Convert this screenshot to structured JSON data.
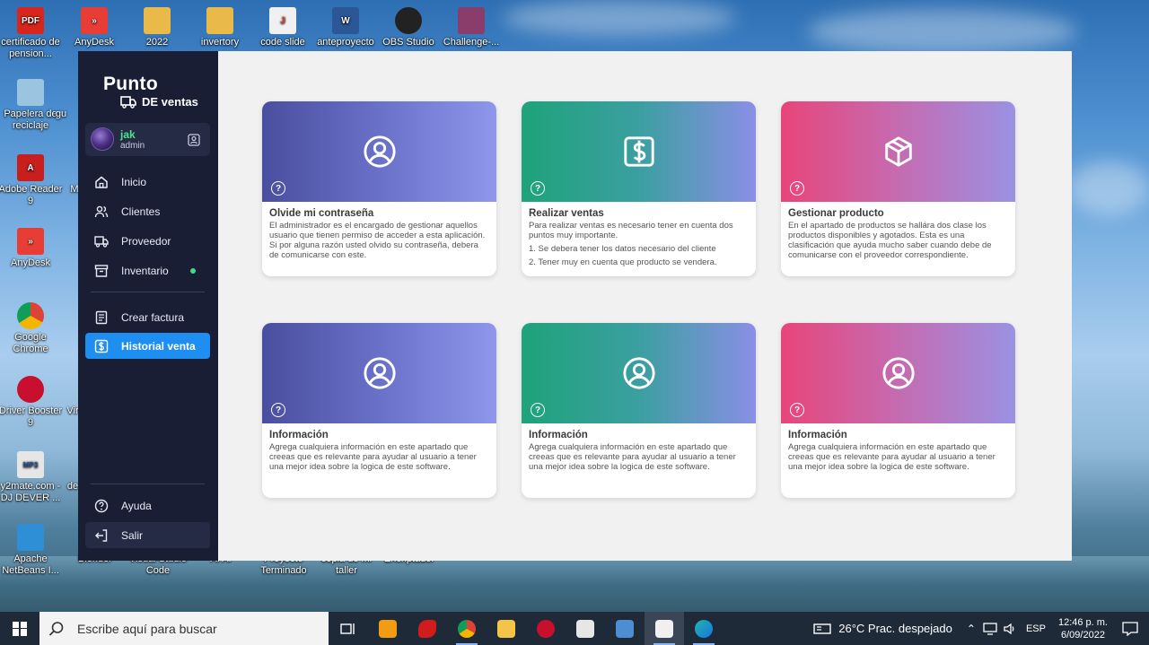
{
  "desktop": {
    "icons": [
      {
        "label": "certificado de pension...",
        "abbr": "PDF",
        "color": "#d9261c"
      },
      {
        "label": "AnyDesk",
        "abbr": "»",
        "color": "#e83d35"
      },
      {
        "label": "2022",
        "abbr": "",
        "color": "#e9b94a"
      },
      {
        "label": "invertory",
        "abbr": "",
        "color": "#e9b94a"
      },
      {
        "label": "code slide",
        "abbr": "J",
        "color": "#f0f0f0"
      },
      {
        "label": "anteproyecto",
        "abbr": "W",
        "color": "#2b5797"
      },
      {
        "label": "OBS Studio",
        "abbr": "",
        "color": "#222222"
      },
      {
        "label": "Challenge-...",
        "abbr": "",
        "color": "#8a3c6b"
      },
      {
        "label": "Papelera de reciclaje",
        "abbr": "",
        "color": "#9bc4e0"
      },
      {
        "label": "gu",
        "abbr": "",
        "color": ""
      },
      {
        "label": "Adobe Reader 9",
        "abbr": "A",
        "color": "#c81e1e"
      },
      {
        "label": "M",
        "abbr": "",
        "color": ""
      },
      {
        "label": "AnyDesk",
        "abbr": "»",
        "color": "#e83d35"
      },
      {
        "label": "Google Chrome",
        "abbr": "",
        "color": "#ffffff"
      },
      {
        "label": "Driver Booster 9",
        "abbr": "",
        "color": "#c8102e"
      },
      {
        "label": "Vir",
        "abbr": "",
        "color": ""
      },
      {
        "label": "y2mate.com - DJ DEVER ...",
        "abbr": "MP3",
        "color": "#e6e6e6"
      },
      {
        "label": "de",
        "abbr": "",
        "color": ""
      },
      {
        "label": "Apache NetBeans I...",
        "abbr": "",
        "color": "#2e8fd6"
      },
      {
        "label": "Blender",
        "abbr": "",
        "color": ""
      },
      {
        "label": "Visual Studio Code",
        "abbr": "",
        "color": ""
      },
      {
        "label": "AI AI",
        "abbr": "",
        "color": ""
      },
      {
        "label": "Proyecto Terminado",
        "abbr": "",
        "color": ""
      },
      {
        "label": "copia de mi taller",
        "abbr": "",
        "color": ""
      },
      {
        "label": "Encriptador",
        "abbr": "",
        "color": ""
      }
    ]
  },
  "app": {
    "brand": {
      "title": "Punto",
      "subtitle": "DE ventas"
    },
    "user": {
      "name": "jak",
      "role": "admin"
    },
    "nav": [
      {
        "label": "Inicio",
        "icon": "home-icon"
      },
      {
        "label": "Clientes",
        "icon": "users-icon"
      },
      {
        "label": "Proveedor",
        "icon": "truck-icon"
      },
      {
        "label": "Inventario",
        "icon": "archive-icon"
      },
      {
        "label": "Crear factura",
        "icon": "receipt-icon"
      },
      {
        "label": "Historial venta",
        "icon": "dollar-icon"
      }
    ],
    "footer_nav": [
      {
        "label": "Ayuda",
        "icon": "help-icon"
      },
      {
        "label": "Salir",
        "icon": "logout-icon"
      }
    ],
    "cards": [
      {
        "title": "Olvide mi contraseña",
        "text": "El administrador es el encargado de gestionar aquellos usuario que tienen permiso de acceder a esta aplicación. Si por alguna razón usted olvido su contraseña, debera de comunicarse con este.",
        "lines": [],
        "icon": "user-circle-icon",
        "gradient": "blue"
      },
      {
        "title": "Realizar ventas",
        "text": "Para realizar ventas es necesario tener en cuenta dos puntos muy importante.",
        "lines": [
          "1. Se debera tener los datos necesario del cliente",
          "2. Tener muy en cuenta que producto se vendera."
        ],
        "icon": "dollar-box-icon",
        "gradient": "green"
      },
      {
        "title": "Gestionar producto",
        "text": "En el apartado de productos se hallára dos clase los productos disponibles y agotados. Esta es una clasificación que ayuda mucho saber cuando debe de comunicarse con el proveedor correspondiente.",
        "lines": [],
        "icon": "box-icon",
        "gradient": "pink"
      },
      {
        "title": "Información",
        "text": "Agrega cualquiera información en este apartado que creeas que es relevante para ayudar al usuario a tener una mejor idea sobre la logica de este software.",
        "lines": [],
        "icon": "user-circle-icon",
        "gradient": "blue"
      },
      {
        "title": "Información",
        "text": "Agrega cualquiera información en este apartado que creeas que es relevante para ayudar al usuario a tener una mejor idea sobre la logica de este software.",
        "lines": [],
        "icon": "user-circle-icon",
        "gradient": "green"
      },
      {
        "title": "Información",
        "text": "Agrega cualquiera información en este apartado que creeas que es relevante para ayudar al usuario a tener una mejor idea sobre la logica de este software.",
        "lines": [],
        "icon": "user-circle-icon",
        "gradient": "pink"
      }
    ]
  },
  "taskbar": {
    "search_placeholder": "Escribe aquí para buscar",
    "weather": "26°C  Prac. despejado",
    "language": "ESP",
    "time": "12:46 p. m.",
    "date": "6/09/2022"
  },
  "colors": {
    "sidebar": "#1a1e35",
    "active_nav": "#1e8ef0",
    "online_dot": "#3ddc84",
    "user_name": "#4ee28a"
  }
}
